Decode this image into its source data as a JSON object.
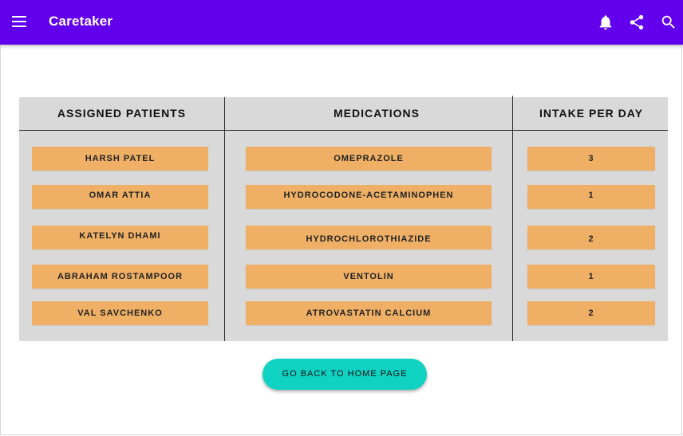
{
  "appbar": {
    "title": "Caretaker",
    "color": "#6200ee",
    "icons": [
      "menu-icon",
      "bell-icon",
      "share-icon",
      "search-icon"
    ]
  },
  "table": {
    "headers": [
      "ASSIGNED PATIENTS",
      "MEDICATIONS",
      "INTAKE PER DAY"
    ],
    "rows": [
      {
        "patient": "HARSH PATEL",
        "medication": "OMEPRAZOLE",
        "intake": "3"
      },
      {
        "patient": "OMAR ATTIA",
        "medication": "HYDROCODONE-ACETAMINOPHEN",
        "intake": "1"
      },
      {
        "patient": "KATELYN DHAMI",
        "medication": "HYDROCHLOROTHIAZIDE",
        "intake": "2"
      },
      {
        "patient": "ABRAHAM ROSTAMPOOR",
        "medication": "VENTOLIN",
        "intake": "1"
      },
      {
        "patient": "VAL SAVCHENKO",
        "medication": "ATROVASTATIN CALCIUM",
        "intake": "2"
      }
    ],
    "cell_color": "#efb066",
    "background_color": "#d9d9d9"
  },
  "actions": {
    "home_button_label": "GO BACK TO HOME PAGE",
    "home_button_color": "#0fd2c2"
  }
}
